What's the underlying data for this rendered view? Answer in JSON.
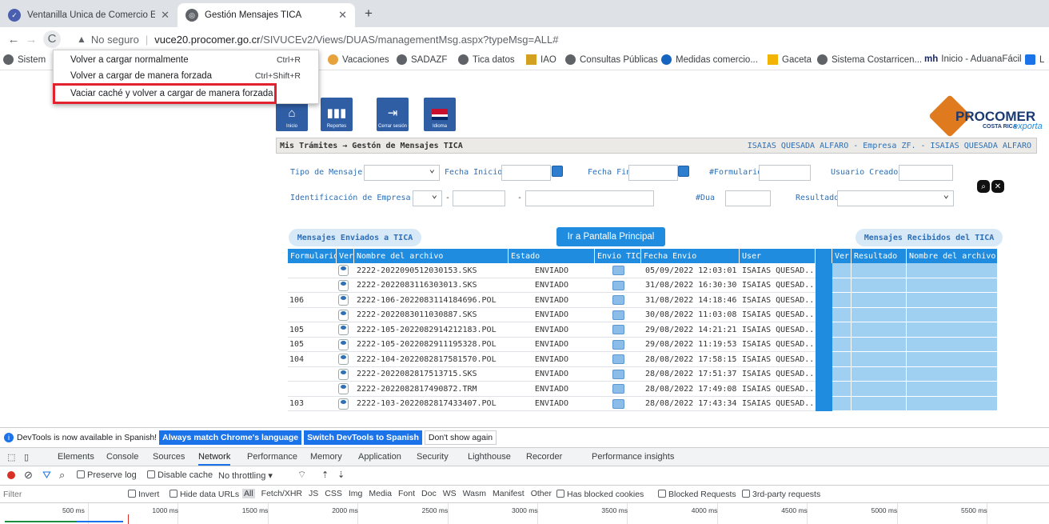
{
  "tabs": [
    {
      "title": "Ventanilla Única de Comercio Ext",
      "active": false
    },
    {
      "title": "Gestión Mensajes TICA",
      "active": true
    }
  ],
  "toolbar": {
    "security_label": "No seguro",
    "url_host": "vuce20.procomer.go.cr",
    "url_path": "/SIVUCEv2/Views/DUAS/managementMsg.aspx?typeMsg=ALL#"
  },
  "bookmarks": [
    "Sistem",
    "Vacaciones",
    "SADAZF",
    "Tica datos",
    "IAO",
    "Consultas Públicas",
    "Medidas comercio...",
    "Gaceta",
    "Sistema Costarricen...",
    "Inicio - AduanaFácil",
    "L"
  ],
  "context_menu": {
    "items": [
      {
        "label": "Volver a cargar normalmente",
        "shortcut": "Ctrl+R"
      },
      {
        "label": "Volver a cargar de manera forzada",
        "shortcut": "Ctrl+Shift+R"
      },
      {
        "label": "Vaciar caché y volver a cargar de manera forzada",
        "shortcut": ""
      }
    ]
  },
  "nav_buttons": [
    "Inicio",
    "Reportes",
    "Cerrar sesión",
    "Idioma"
  ],
  "logo": {
    "name": "PROCOMER",
    "tagline": "COSTA RICA",
    "script": "exporta"
  },
  "breadcrumb": {
    "path": "Mis Trámites → Gestón de Mensajes TICA",
    "user": "ISAIAS QUESADA ALFARO - Empresa ZF. - ISAIAS QUESADA ALFARO"
  },
  "filters": {
    "tipo_mensaje": "Tipo de Mensaje",
    "fecha_inicio": "Fecha Inicio",
    "fecha_fin": "Fecha Fin",
    "formulario": "#Formulario",
    "usuario_creador": "Usuario Creador",
    "identificacion": "Identificación de Empresa",
    "dash1": "-",
    "dash2": "-",
    "dua": "#Dua",
    "resultado": "Resultado"
  },
  "section": {
    "enviados": "Mensajes Enviados a TICA",
    "recibidos": "Mensajes Recibidos del TICA",
    "main_button": "Ir a Pantalla Principal"
  },
  "table": {
    "headers": [
      "Formulario",
      "Ver",
      "Nombre del archivo",
      "Estado",
      "Envio TICA",
      "Fecha Envio",
      "User",
      "",
      "Ver",
      "Resultado",
      "Nombre del archivo"
    ],
    "rows": [
      {
        "formulario": "",
        "archivo": "2222-2022090512030153.SKS",
        "estado": "ENVIADO",
        "fecha": "05/09/2022 12:03:01",
        "user": "ISAIAS QUESAD..."
      },
      {
        "formulario": "",
        "archivo": "2222-2022083116303013.SKS",
        "estado": "ENVIADO",
        "fecha": "31/08/2022 16:30:30",
        "user": "ISAIAS QUESAD..."
      },
      {
        "formulario": "106",
        "archivo": "2222-106-2022083114184696.POL",
        "estado": "ENVIADO",
        "fecha": "31/08/2022 14:18:46",
        "user": "ISAIAS QUESAD..."
      },
      {
        "formulario": "",
        "archivo": "2222-2022083011030887.SKS",
        "estado": "ENVIADO",
        "fecha": "30/08/2022 11:03:08",
        "user": "ISAIAS QUESAD..."
      },
      {
        "formulario": "105",
        "archivo": "2222-105-2022082914212183.POL",
        "estado": "ENVIADO",
        "fecha": "29/08/2022 14:21:21",
        "user": "ISAIAS QUESAD..."
      },
      {
        "formulario": "105",
        "archivo": "2222-105-2022082911195328.POL",
        "estado": "ENVIADO",
        "fecha": "29/08/2022 11:19:53",
        "user": "ISAIAS QUESAD..."
      },
      {
        "formulario": "104",
        "archivo": "2222-104-2022082817581570.POL",
        "estado": "ENVIADO",
        "fecha": "28/08/2022 17:58:15",
        "user": "ISAIAS QUESAD..."
      },
      {
        "formulario": "",
        "archivo": "2222-2022082817513715.SKS",
        "estado": "ENVIADO",
        "fecha": "28/08/2022 17:51:37",
        "user": "ISAIAS QUESAD..."
      },
      {
        "formulario": "",
        "archivo": "2222-2022082817490872.TRM",
        "estado": "ENVIADO",
        "fecha": "28/08/2022 17:49:08",
        "user": "ISAIAS QUESAD..."
      },
      {
        "formulario": "103",
        "archivo": "2222-103-2022082817433407.POL",
        "estado": "ENVIADO",
        "fecha": "28/08/2022 17:43:34",
        "user": "ISAIAS QUESAD..."
      }
    ]
  },
  "devtools": {
    "info": "DevTools is now available in Spanish!",
    "btn_match": "Always match Chrome's language",
    "btn_switch": "Switch DevTools to Spanish",
    "btn_dismiss": "Don't show again",
    "tabs": [
      "Elements",
      "Console",
      "Sources",
      "Network",
      "Performance",
      "Memory",
      "Application",
      "Security",
      "Lighthouse",
      "Recorder",
      "Performance insights"
    ],
    "preserve_log": "Preserve log",
    "disable_cache": "Disable cache",
    "throttling": "No throttling",
    "filter_placeholder": "Filter",
    "invert": "Invert",
    "hide_data": "Hide data URLs",
    "types": [
      "All",
      "Fetch/XHR",
      "JS",
      "CSS",
      "Img",
      "Media",
      "Font",
      "Doc",
      "WS",
      "Wasm",
      "Manifest",
      "Other"
    ],
    "blocked_cookies": "Has blocked cookies",
    "blocked_requests": "Blocked Requests",
    "third_party": "3rd-party requests",
    "ticks": [
      "500 ms",
      "1000 ms",
      "1500 ms",
      "2000 ms",
      "2500 ms",
      "3000 ms",
      "3500 ms",
      "4000 ms",
      "4500 ms",
      "5000 ms",
      "5500 ms"
    ]
  },
  "colors": {
    "accent": "#1f8ce0",
    "menu_highlight": "#e3222f",
    "table_blue": "#9fcff1"
  }
}
